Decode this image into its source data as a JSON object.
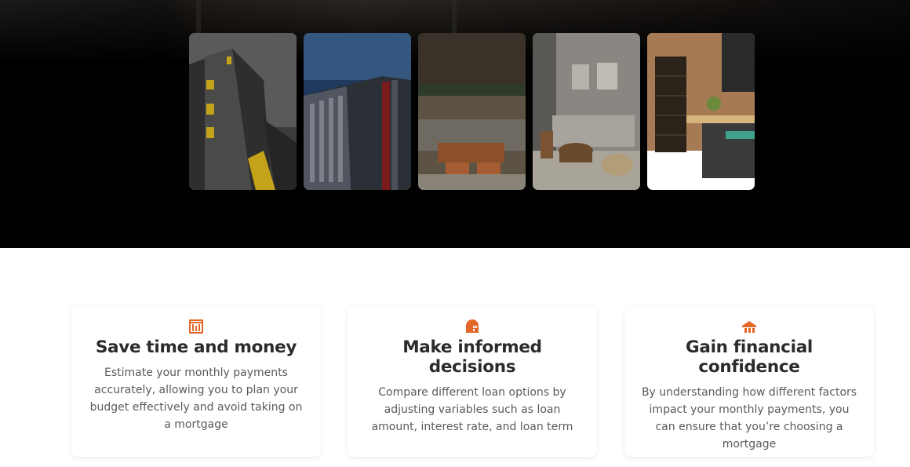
{
  "hero": {
    "photos": [
      {
        "alt": "tall apartment building with yellow balconies",
        "icon": "building-photo"
      },
      {
        "alt": "high-rise tower against blue sky",
        "icon": "tower-photo"
      },
      {
        "alt": "living room with leather ottomans",
        "icon": "living-room-photo"
      },
      {
        "alt": "modern lounge with round coffee table",
        "icon": "lounge-photo"
      },
      {
        "alt": "kitchen with wine cabinet and bar stools",
        "icon": "kitchen-photo"
      }
    ]
  },
  "accent_color": "#e4672a",
  "features": [
    {
      "icon": "calculator-icon",
      "title": "Save time and money",
      "lines": [
        "Estimate your monthly payments",
        "accurately, allowing you to plan your",
        "budget effectively and avoid taking on",
        "a mortgage"
      ]
    },
    {
      "icon": "house-icon",
      "title": "Make informed decisions",
      "lines": [
        "Compare different loan options by",
        "adjusting variables such as loan",
        "amount, interest rate, and loan term"
      ]
    },
    {
      "icon": "home-roof-icon",
      "title": "Gain financial confidence",
      "lines": [
        "By understanding how different factors",
        "impact your monthly payments, you",
        "can ensure that you’re choosing a",
        "mortgage"
      ]
    }
  ]
}
